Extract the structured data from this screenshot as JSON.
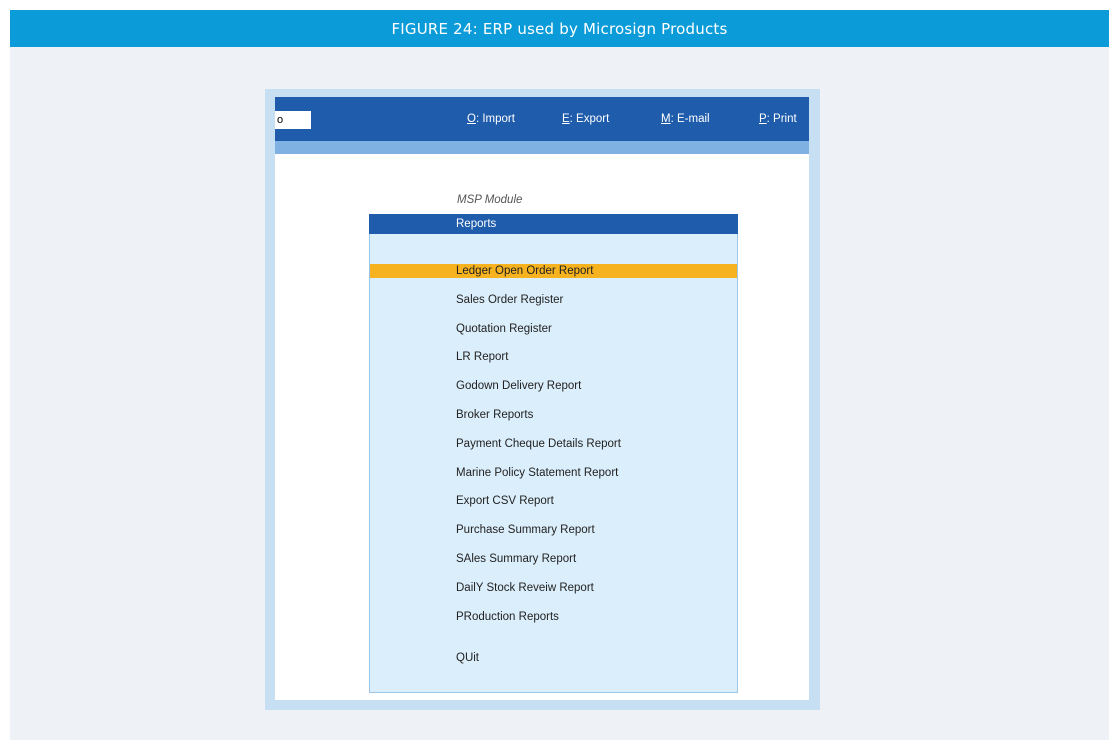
{
  "figure": {
    "title": "FIGURE 24: ERP used by Microsign Products"
  },
  "toolbar": {
    "input_value": "o",
    "buttons": [
      {
        "key": "O",
        "label": ": Import"
      },
      {
        "key": "E",
        "label": ": Export"
      },
      {
        "key": "M",
        "label": ": E-mail"
      },
      {
        "key": "P",
        "label": ": Print"
      }
    ]
  },
  "module": {
    "caption": "MSP Module"
  },
  "menu": {
    "title": "Reports",
    "selected_index": 0,
    "items": [
      "Ledger Open Order Report",
      "Sales Order Register",
      "Quotation Register",
      "LR Report",
      "Godown Delivery Report",
      "Broker Reports",
      "Payment Cheque Details Report",
      "Marine Policy Statement Report",
      "Export CSV Report",
      "Purchase Summary Report",
      "SAles Summary Report",
      "DailY Stock Reveiw Report",
      "PRoduction Reports",
      "QUit"
    ]
  },
  "colors": {
    "header_blue": "#0a9bd8",
    "toolbar_blue": "#1f5cab",
    "selected_highlight": "#f6b31f",
    "panel_bg": "#dbeefb"
  }
}
